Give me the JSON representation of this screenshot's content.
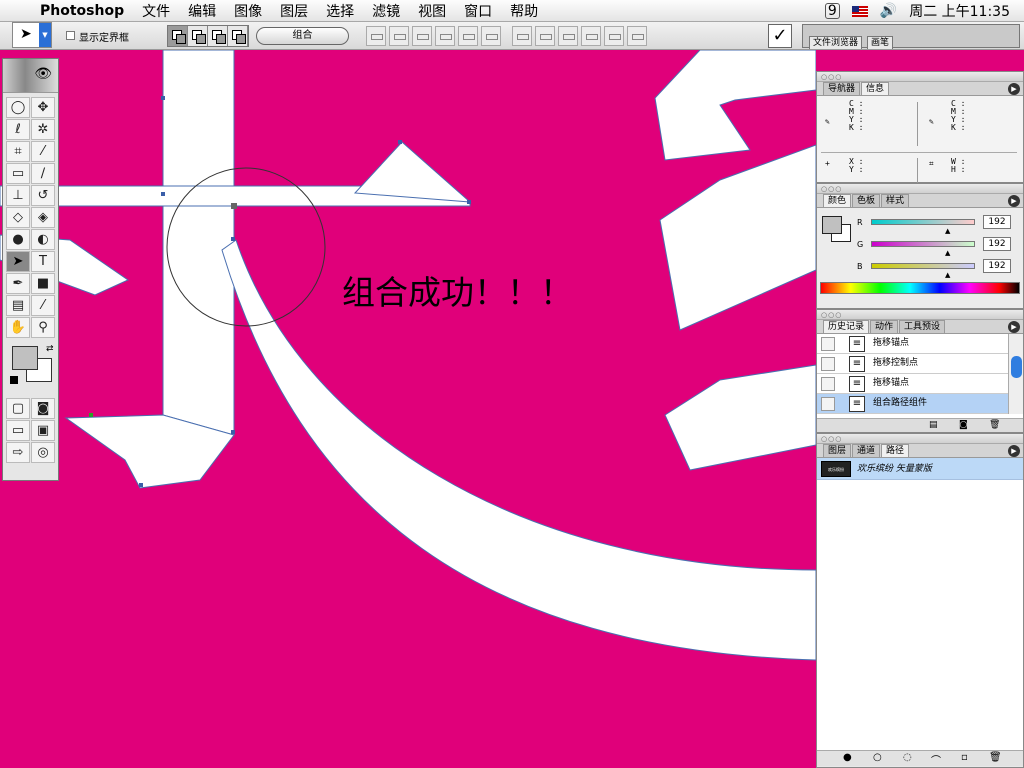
{
  "menubar": {
    "apple_icon": "apple-logo-icon",
    "app_name": "Photoshop",
    "items": [
      "文件",
      "编辑",
      "图像",
      "图层",
      "选择",
      "滤镜",
      "视图",
      "窗口",
      "帮助"
    ],
    "sync_badge": "9",
    "volume_icon": "speaker-icon",
    "clock": "周二 上午11:35"
  },
  "options_bar": {
    "tool_icon": "path-selection-arrow-icon",
    "show_bounding_box_label": "显示定界框",
    "show_bounding_box_checked": false,
    "combine_label": "组合",
    "confirm_glyph": "✓",
    "well_tabs": [
      "文件浏览器",
      "画笔"
    ]
  },
  "canvas": {
    "background": "#e0007a",
    "caption": "组合成功！！！"
  },
  "toolbox": {
    "tools": [
      "marquee",
      "move",
      "lasso",
      "magic-wand",
      "crop",
      "slice",
      "healing",
      "brush",
      "stamp",
      "history-brush",
      "eraser",
      "paint-bucket",
      "blur",
      "dodge",
      "path-selection",
      "type",
      "pen",
      "shape",
      "notes",
      "eyedropper",
      "hand",
      "zoom"
    ],
    "foreground_color": "#c0c0c0",
    "background_color": "#ffffff"
  },
  "navigator_panel": {
    "tabs": [
      "导航器",
      "信息"
    ],
    "active_tab": "信息",
    "cmyk_left": [
      "C :",
      "M :",
      "Y :",
      "K :"
    ],
    "cmyk_right": [
      "C :",
      "M :",
      "Y :",
      "K :"
    ],
    "xy": [
      "X :",
      "Y :"
    ],
    "wh": [
      "W :",
      "H :"
    ]
  },
  "color_panel": {
    "tabs": [
      "颜色",
      "色板",
      "样式"
    ],
    "active_tab": "颜色",
    "channels": [
      {
        "label": "R",
        "value": "192"
      },
      {
        "label": "G",
        "value": "192"
      },
      {
        "label": "B",
        "value": "192"
      }
    ],
    "swatch_fg": "#c0c0c0"
  },
  "history_panel": {
    "tabs": [
      "历史记录",
      "动作",
      "工具预设"
    ],
    "active_tab": "历史记录",
    "items": [
      "拖移锚点",
      "拖移控制点",
      "拖移锚点",
      "组合路径组件"
    ],
    "selected_index": 3
  },
  "layers_panel": {
    "tabs": [
      "图层",
      "通道",
      "路径"
    ],
    "active_tab": "路径",
    "paths": [
      {
        "label": "欢乐缤纷 矢量蒙版",
        "thumb": "欢乐缤纷"
      }
    ]
  }
}
